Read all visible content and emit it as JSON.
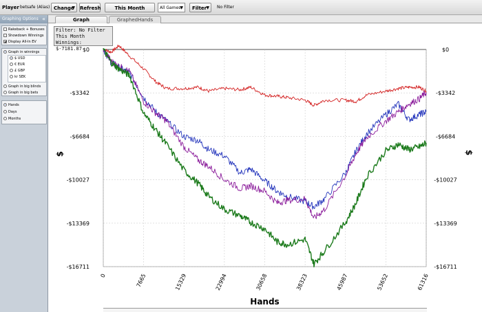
{
  "toolbar": {
    "player_label": "Player",
    "player_name": "betsafe (Alias)",
    "change_label": "Change",
    "refresh_label": "Refresh",
    "period_label": "This Month",
    "games_value": "All Games",
    "filter_label": "Filter",
    "filter_status": "No Filter"
  },
  "tabs": [
    {
      "label": "Graph",
      "active": true
    },
    {
      "label": "GraphedHands",
      "active": false
    }
  ],
  "sidebar": {
    "title": "Graphing Options",
    "collapse_icon": "double-chevron-left-icon",
    "checkboxes": [
      {
        "label": "Rakeback + Bonuses",
        "checked": false
      },
      {
        "label": "Showdown Winnings",
        "checked": false
      },
      {
        "label": "Display All-In EV",
        "checked": true
      }
    ],
    "unit_options": [
      {
        "label": "Graph in winnings",
        "selected": true
      },
      {
        "label": "Graph in big blinds",
        "selected": false
      },
      {
        "label": "Graph in big bets",
        "selected": false
      }
    ],
    "currency_options": [
      {
        "label": "$ USD",
        "selected": true
      },
      {
        "label": "€ EUR",
        "selected": false
      },
      {
        "label": "£ GBP",
        "selected": false
      },
      {
        "label": "kr SEK",
        "selected": false
      }
    ],
    "xaxis_options": [
      {
        "label": "Hands",
        "selected": true
      },
      {
        "label": "Days",
        "selected": false
      },
      {
        "label": "Months",
        "selected": false
      }
    ]
  },
  "filter_box": {
    "line1": "Filter: No Filter",
    "line2": "This Month",
    "line3": "Winnings: $-7181.87"
  },
  "chart_data": {
    "type": "line",
    "xlabel": "Hands",
    "ylabel": "$",
    "x_ticks": [
      "0",
      "7665",
      "15329",
      "22994",
      "30658",
      "38323",
      "45987",
      "53652",
      "61316"
    ],
    "y_ticks": [
      "$0",
      "-$3342",
      "-$6684",
      "-$10027",
      "-$13369",
      "-$16711"
    ],
    "xlim": [
      0,
      61316
    ],
    "ylim": [
      -16711,
      0
    ],
    "grid": true,
    "series": [
      {
        "color": "#d32020",
        "x": [
          0,
          1500,
          3000,
          5000,
          7665,
          10000,
          12000,
          15329,
          18000,
          20000,
          22994,
          26000,
          28000,
          30658,
          33000,
          35000,
          38323,
          40000,
          42000,
          45987,
          48000,
          50000,
          53652,
          56000,
          58000,
          60000,
          61316
        ],
        "y": [
          0,
          -200,
          300,
          -500,
          -1500,
          -2500,
          -3000,
          -3000,
          -2900,
          -3200,
          -3000,
          -3100,
          -2900,
          -3500,
          -3600,
          -3700,
          -3900,
          -4300,
          -3900,
          -3900,
          -4000,
          -3500,
          -3200,
          -3000,
          -2900,
          -2900,
          -3200
        ]
      },
      {
        "color": "#2233bb",
        "x": [
          0,
          1500,
          3000,
          5000,
          7665,
          10000,
          12000,
          15329,
          18000,
          20000,
          22994,
          26000,
          28000,
          30658,
          33000,
          35000,
          38323,
          40000,
          42000,
          45987,
          48000,
          50000,
          53652,
          56000,
          58000,
          60000,
          61316
        ],
        "y": [
          0,
          -1000,
          -1400,
          -1800,
          -3700,
          -4800,
          -5500,
          -6700,
          -7000,
          -7700,
          -8200,
          -9500,
          -9200,
          -10100,
          -10900,
          -11300,
          -11700,
          -12100,
          -11500,
          -9500,
          -7800,
          -6500,
          -5000,
          -4200,
          -5400,
          -5000,
          -4800
        ]
      },
      {
        "color": "#8a1a9a",
        "x": [
          0,
          1500,
          3000,
          5000,
          7665,
          10000,
          12000,
          15329,
          18000,
          20000,
          22994,
          26000,
          28000,
          30658,
          33000,
          35000,
          38323,
          40000,
          42000,
          45987,
          48000,
          50000,
          53652,
          56000,
          58000,
          60000,
          61316
        ],
        "y": [
          0,
          -900,
          -1300,
          -1700,
          -4000,
          -4900,
          -5500,
          -7500,
          -8500,
          -9000,
          -10000,
          -10700,
          -10500,
          -10900,
          -11800,
          -11600,
          -11500,
          -13000,
          -12300,
          -9700,
          -8000,
          -6800,
          -5500,
          -4800,
          -4200,
          -3800,
          -3300
        ]
      },
      {
        "color": "#1b7a1b",
        "x": [
          0,
          1500,
          3000,
          5000,
          7665,
          10000,
          12000,
          15329,
          18000,
          20000,
          22994,
          26000,
          28000,
          30658,
          33000,
          35000,
          38323,
          40000,
          42000,
          45987,
          48000,
          50000,
          53652,
          56000,
          58000,
          60000,
          61316
        ],
        "y": [
          0,
          -1000,
          -1500,
          -2000,
          -4900,
          -6200,
          -7300,
          -9300,
          -10300,
          -11300,
          -12300,
          -12800,
          -13300,
          -13800,
          -14800,
          -15000,
          -14600,
          -16500,
          -15500,
          -13300,
          -11800,
          -9800,
          -7800,
          -7300,
          -7700,
          -7500,
          -7200
        ]
      }
    ]
  }
}
